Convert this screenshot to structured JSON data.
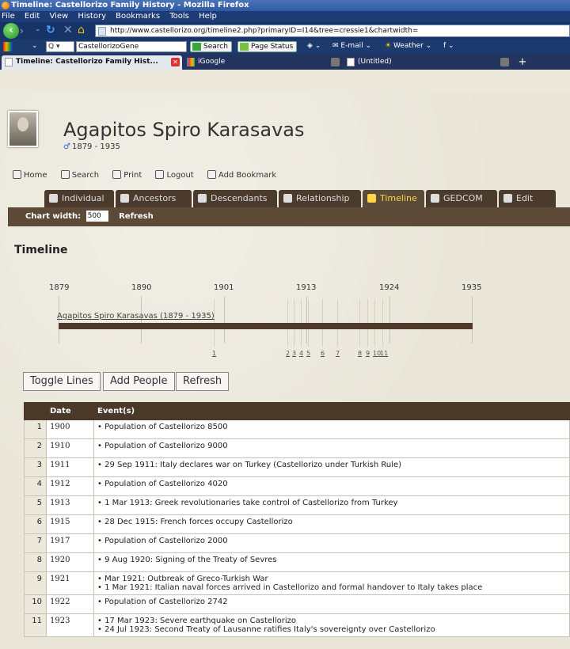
{
  "window": {
    "title": "Timeline: Castellorizo Family History - Mozilla Firefox"
  },
  "menu": [
    "File",
    "Edit",
    "View",
    "History",
    "Bookmarks",
    "Tools",
    "Help"
  ],
  "nav": {
    "url": "http://www.castellorizo.org/timeline2.php?primaryID=I14&tree=cressie1&chartwidth="
  },
  "search_toolbar": {
    "engine_dropdown": "Q ▾",
    "search_value": "CastellorizoGene",
    "search_button": "Search",
    "page_status": "Page Status",
    "email": "E-mail",
    "weather": "Weather"
  },
  "browser_tabs": [
    {
      "label": "Timeline: Castellorizo Family Hist...",
      "active": true
    },
    {
      "label": "iGoogle",
      "active": false
    },
    {
      "label": "(Untitled)",
      "active": false
    }
  ],
  "person": {
    "name": "Agapitos Spiro Karasavas",
    "dates": "1879 - 1935",
    "gender_icon": "male-icon"
  },
  "toplinks": [
    "Home",
    "Search",
    "Print",
    "Logout",
    "Add Bookmark"
  ],
  "page_tabs": [
    {
      "label": "Individual"
    },
    {
      "label": "Ancestors"
    },
    {
      "label": "Descendants"
    },
    {
      "label": "Relationship"
    },
    {
      "label": "Timeline",
      "active": true
    },
    {
      "label": "GEDCOM"
    },
    {
      "label": "Edit"
    }
  ],
  "chart_controls": {
    "width_label": "Chart width:",
    "width_value": "500",
    "refresh": "Refresh"
  },
  "section_title": "Timeline",
  "timeline": {
    "years": [
      "1879",
      "1890",
      "1901",
      "1913",
      "1924",
      "1935"
    ],
    "bar_label": "Agapitos Spiro Karasavas (1879 - 1935)",
    "event_markers": [
      "1",
      "2",
      "3",
      "4",
      "5",
      "6",
      "7",
      "8",
      "9",
      "10",
      "11"
    ]
  },
  "buttons": {
    "toggle_lines": "Toggle Lines",
    "add_people": "Add People",
    "refresh": "Refresh"
  },
  "table": {
    "headers": [
      "",
      "Date",
      "Event(s)"
    ],
    "rows": [
      {
        "n": "1",
        "date": "1900",
        "events": [
          "Population of Castellorizo 8500"
        ]
      },
      {
        "n": "2",
        "date": "1910",
        "events": [
          "Population of Castellorizo 9000"
        ]
      },
      {
        "n": "3",
        "date": "1911",
        "events": [
          "29 Sep 1911: Italy declares war on Turkey (Castellorizo under Turkish Rule)"
        ]
      },
      {
        "n": "4",
        "date": "1912",
        "events": [
          "Population of Castellorizo 4020"
        ]
      },
      {
        "n": "5",
        "date": "1913",
        "events": [
          "1 Mar 1913: Greek revolutionaries take control of Castellorizo from Turkey"
        ]
      },
      {
        "n": "6",
        "date": "1915",
        "events": [
          "28 Dec 1915: French forces occupy Castellorizo"
        ]
      },
      {
        "n": "7",
        "date": "1917",
        "events": [
          "Population of Castellorizo 2000"
        ]
      },
      {
        "n": "8",
        "date": "1920",
        "events": [
          "9 Aug 1920: Signing of the Treaty of Sevres"
        ]
      },
      {
        "n": "9",
        "date": "1921",
        "events": [
          "Mar 1921: Outbreak of Greco-Turkish War",
          "1 Mar 1921: Italian naval forces arrived in Castellorizo and formal handover to Italy takes place"
        ]
      },
      {
        "n": "10",
        "date": "1922",
        "events": [
          "Population of Castellorizo 2742"
        ]
      },
      {
        "n": "11",
        "date": "1923",
        "events": [
          "17 Mar 1923: Severe earthquake on Castellorizo",
          "24 Jul 1923: Second Treaty of Lausanne ratifies Italy's sovereignty over Castellorizo"
        ]
      }
    ]
  }
}
